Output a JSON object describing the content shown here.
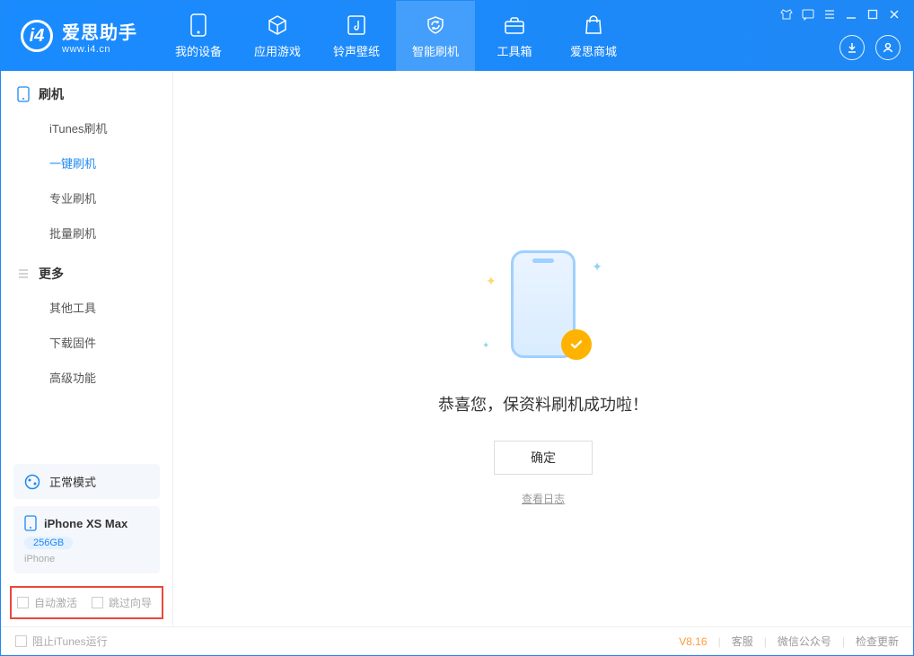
{
  "app": {
    "title": "爱思助手",
    "subtitle": "www.i4.cn"
  },
  "tabs": [
    {
      "label": "我的设备"
    },
    {
      "label": "应用游戏"
    },
    {
      "label": "铃声壁纸"
    },
    {
      "label": "智能刷机"
    },
    {
      "label": "工具箱"
    },
    {
      "label": "爱思商城"
    }
  ],
  "sidebar": {
    "section1": {
      "title": "刷机",
      "items": [
        {
          "label": "iTunes刷机"
        },
        {
          "label": "一键刷机"
        },
        {
          "label": "专业刷机"
        },
        {
          "label": "批量刷机"
        }
      ]
    },
    "section2": {
      "title": "更多",
      "items": [
        {
          "label": "其他工具"
        },
        {
          "label": "下载固件"
        },
        {
          "label": "高级功能"
        }
      ]
    }
  },
  "mode": {
    "label": "正常模式"
  },
  "device": {
    "name": "iPhone XS Max",
    "storage": "256GB",
    "type": "iPhone"
  },
  "options": {
    "auto_activate": "自动激活",
    "skip_guide": "跳过向导"
  },
  "main": {
    "message": "恭喜您，保资料刷机成功啦！",
    "ok": "确定",
    "view_log": "查看日志"
  },
  "footer": {
    "block_itunes": "阻止iTunes运行",
    "version": "V8.16",
    "support": "客服",
    "wechat": "微信公众号",
    "update": "检查更新"
  }
}
